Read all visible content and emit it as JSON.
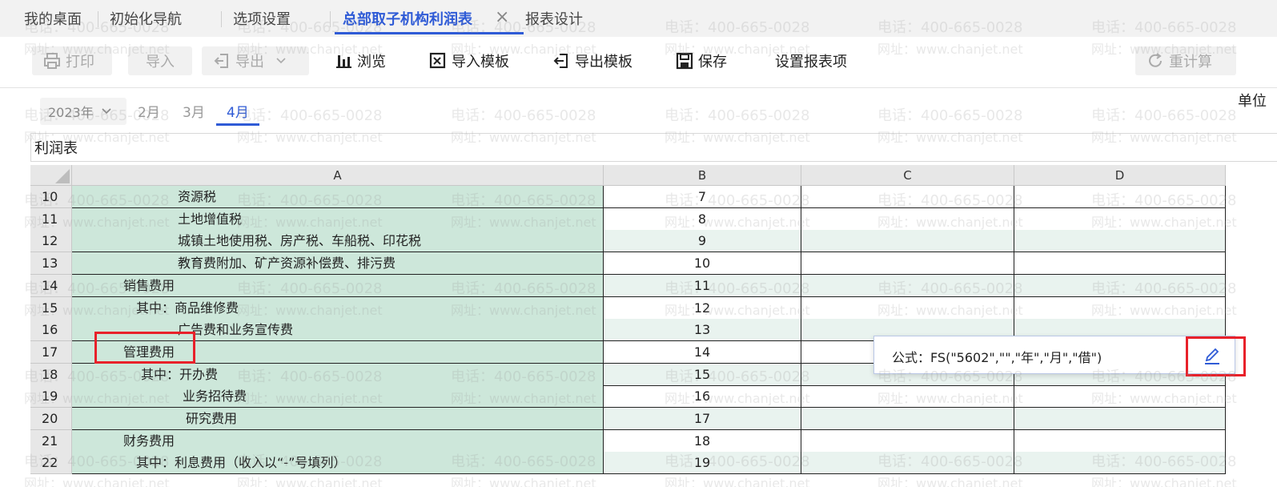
{
  "tabs": [
    {
      "label": "我的桌面"
    },
    {
      "label": "初始化导航"
    },
    {
      "label": "选项设置"
    },
    {
      "label": "总部取子机构利润表",
      "active": true
    },
    {
      "label": "报表设计"
    }
  ],
  "tab_close_glyph": "×",
  "toolbar": {
    "print": "打印",
    "import": "导入",
    "export": "导出",
    "browse": "浏览",
    "import_template": "导入模板",
    "export_template": "导出模板",
    "save": "保存",
    "report_settings": "设置报表项",
    "recalculate": "重计算"
  },
  "period": {
    "year": "2023年",
    "months": [
      "2月",
      "3月",
      "4月"
    ],
    "active_month": "4月",
    "unit_label": "单位"
  },
  "report_name": "利润表",
  "columns": [
    "A",
    "B",
    "C",
    "D"
  ],
  "rows": [
    {
      "num": "10",
      "a": "资源税",
      "b": "7"
    },
    {
      "num": "11",
      "a": "土地增值税",
      "b": "8"
    },
    {
      "num": "12",
      "a": "城镇土地使用税、房产税、车船税、印花税",
      "b": "9"
    },
    {
      "num": "13",
      "a": "教育费附加、矿产资源补偿费、排污费",
      "b": "10"
    },
    {
      "num": "14",
      "a": "销售费用",
      "b": "11"
    },
    {
      "num": "15",
      "a": "其中：商品维修费",
      "b": "12"
    },
    {
      "num": "16",
      "a": "广告费和业务宣传费",
      "b": "13"
    },
    {
      "num": "17",
      "a": "管理费用",
      "b": "14"
    },
    {
      "num": "18",
      "a": "其中：开办费",
      "b": "15"
    },
    {
      "num": "19",
      "a": "业务招待费",
      "b": "16"
    },
    {
      "num": "20",
      "a": "研究费用",
      "b": "17"
    },
    {
      "num": "21",
      "a": "财务费用",
      "b": "18"
    },
    {
      "num": "22",
      "a": "其中：利息费用（收入以“-”号填列）",
      "b": "19"
    }
  ],
  "formula_popup": {
    "text": "公式：FS(\"5602\",\"\",\"年\",\"月\",\"借\")"
  },
  "watermark": {
    "phone": "电话：400-665-0028",
    "site": "网址：www.chanjet.net"
  },
  "colors": {
    "accent": "#2f5bd6",
    "highlight": "#e8212a",
    "cell_green": "#cde7da"
  }
}
